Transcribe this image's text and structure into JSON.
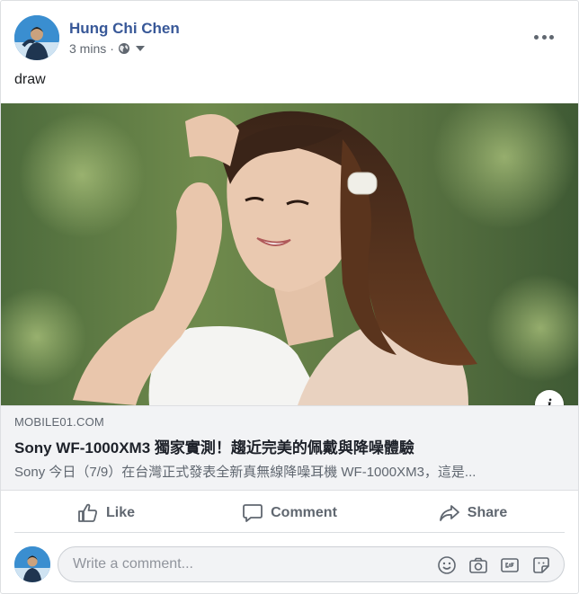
{
  "post": {
    "author": "Hung Chi Chen",
    "time": "3 mins",
    "separator": "·",
    "privacy_icon": "globe-icon",
    "message": "draw"
  },
  "link_preview": {
    "domain": "MOBILE01.COM",
    "title": "Sony WF-1000XM3 獨家實測！趨近完美的佩戴與降噪體驗",
    "description": "Sony 今日（7/9）在台灣正式發表全新真無線降噪耳機 WF-1000XM3，這是...",
    "info_label": "i"
  },
  "actions": {
    "like": "Like",
    "comment": "Comment",
    "share": "Share"
  },
  "composer": {
    "placeholder": "Write a comment...",
    "icons": [
      "emoji-icon",
      "camera-icon",
      "gif-icon",
      "sticker-icon"
    ]
  },
  "colors": {
    "author": "#385898",
    "muted": "#606770",
    "link_bg": "#f2f3f5"
  }
}
